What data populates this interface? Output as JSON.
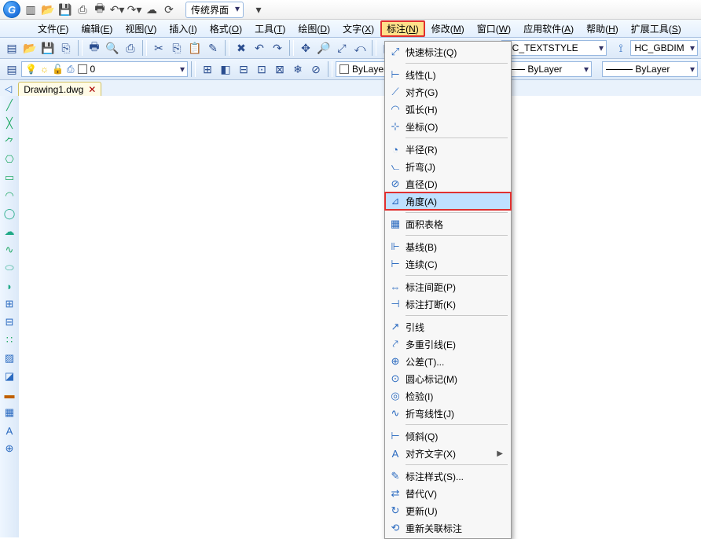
{
  "titlebar": {
    "interface_label": "传统界面"
  },
  "menu": [
    {
      "l": "文件",
      "k": "F"
    },
    {
      "l": "编辑",
      "k": "E"
    },
    {
      "l": "视图",
      "k": "V"
    },
    {
      "l": "插入",
      "k": "I"
    },
    {
      "l": "格式",
      "k": "O"
    },
    {
      "l": "工具",
      "k": "T"
    },
    {
      "l": "绘图",
      "k": "D"
    },
    {
      "l": "文字",
      "k": "X"
    },
    {
      "l": "标注",
      "k": "N",
      "hl": true
    },
    {
      "l": "修改",
      "k": "M"
    },
    {
      "l": "窗口",
      "k": "W"
    },
    {
      "l": "应用软件",
      "k": "A"
    },
    {
      "l": "帮助",
      "k": "H"
    },
    {
      "l": "扩展工具",
      "k": "S"
    }
  ],
  "props": {
    "layer": "0",
    "color": "ByLayer",
    "textstyle": "HC_TEXTSTYLE",
    "dimstyle": "HC_GBDIM",
    "linetype1": "ByLayer",
    "linetype2": "ByLayer"
  },
  "tab": {
    "name": "Drawing1.dwg"
  },
  "dd": [
    {
      "t": "i",
      "lab": "快速标注(Q)",
      "ic": "⤢"
    },
    {
      "t": "s"
    },
    {
      "t": "i",
      "lab": "线性(L)",
      "ic": "⊢"
    },
    {
      "t": "i",
      "lab": "对齐(G)",
      "ic": "⟋"
    },
    {
      "t": "i",
      "lab": "弧长(H)",
      "ic": "◠"
    },
    {
      "t": "i",
      "lab": "坐标(O)",
      "ic": "⊹"
    },
    {
      "t": "s"
    },
    {
      "t": "i",
      "lab": "半径(R)",
      "ic": "◔"
    },
    {
      "t": "i",
      "lab": "折弯(J)",
      "ic": "⦦"
    },
    {
      "t": "i",
      "lab": "直径(D)",
      "ic": "⊘"
    },
    {
      "t": "i",
      "lab": "角度(A)",
      "ic": "⊿",
      "hi": true,
      "box": true
    },
    {
      "t": "s"
    },
    {
      "t": "i",
      "lab": "面积表格",
      "ic": "▦"
    },
    {
      "t": "s"
    },
    {
      "t": "i",
      "lab": "基线(B)",
      "ic": "⊩"
    },
    {
      "t": "i",
      "lab": "连续(C)",
      "ic": "⊢"
    },
    {
      "t": "s"
    },
    {
      "t": "i",
      "lab": "标注间距(P)",
      "ic": "⇔"
    },
    {
      "t": "i",
      "lab": "标注打断(K)",
      "ic": "⊣"
    },
    {
      "t": "s"
    },
    {
      "t": "i",
      "lab": "引线",
      "ic": "↗"
    },
    {
      "t": "i",
      "lab": "多重引线(E)",
      "ic": "⤤"
    },
    {
      "t": "i",
      "lab": "公差(T)...",
      "ic": "⊕"
    },
    {
      "t": "i",
      "lab": "圆心标记(M)",
      "ic": "⊙"
    },
    {
      "t": "i",
      "lab": "检验(I)",
      "ic": "◎"
    },
    {
      "t": "i",
      "lab": "折弯线性(J)",
      "ic": "∿"
    },
    {
      "t": "s"
    },
    {
      "t": "i",
      "lab": "倾斜(Q)",
      "ic": "⊢"
    },
    {
      "t": "i",
      "lab": "对齐文字(X)",
      "ic": "A",
      "sub": true
    },
    {
      "t": "s"
    },
    {
      "t": "i",
      "lab": "标注样式(S)...",
      "ic": "✎"
    },
    {
      "t": "i",
      "lab": "替代(V)",
      "ic": "⇄"
    },
    {
      "t": "i",
      "lab": "更新(U)",
      "ic": "↻"
    },
    {
      "t": "i",
      "lab": "重新关联标注",
      "ic": "⟲"
    }
  ]
}
